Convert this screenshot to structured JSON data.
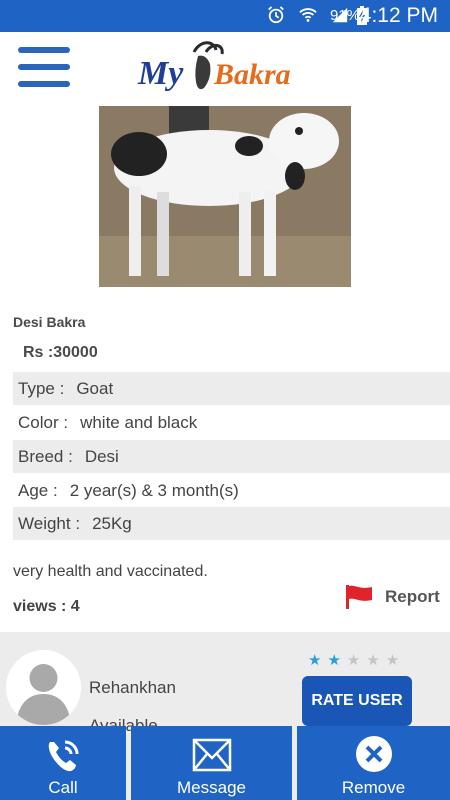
{
  "status_bar": {
    "battery_percent": "91%",
    "time": "4:12 PM",
    "icons": [
      "alarm-icon",
      "wifi-icon",
      "signal-icon",
      "battery-charging-icon"
    ]
  },
  "header": {
    "menu_icon": "hamburger-menu-icon",
    "logo_my": "My",
    "logo_bakra": "Bakra"
  },
  "listing": {
    "title": "Desi Bakra",
    "price": "Rs :30000",
    "attributes": [
      {
        "label": "Type :",
        "value": "Goat"
      },
      {
        "label": "Color :",
        "value": "white and black"
      },
      {
        "label": "Breed :",
        "value": "Desi"
      },
      {
        "label": "Age :",
        "value": "2 year(s) & 3 month(s)"
      },
      {
        "label": "Weight :",
        "value": "25Kg"
      }
    ],
    "description": "very health and vaccinated.",
    "views": "views : 4",
    "report_label": "Report"
  },
  "seller": {
    "name": "Rehankhan",
    "availability": "Available",
    "rating": 2,
    "rating_max": 5,
    "rate_button": "RATE USER"
  },
  "bottom_bar": {
    "call": "Call",
    "message": "Message",
    "remove": "Remove"
  },
  "colors": {
    "primary": "#1f64c4",
    "star_on": "#2a9fd8",
    "flag": "#e0242b"
  }
}
